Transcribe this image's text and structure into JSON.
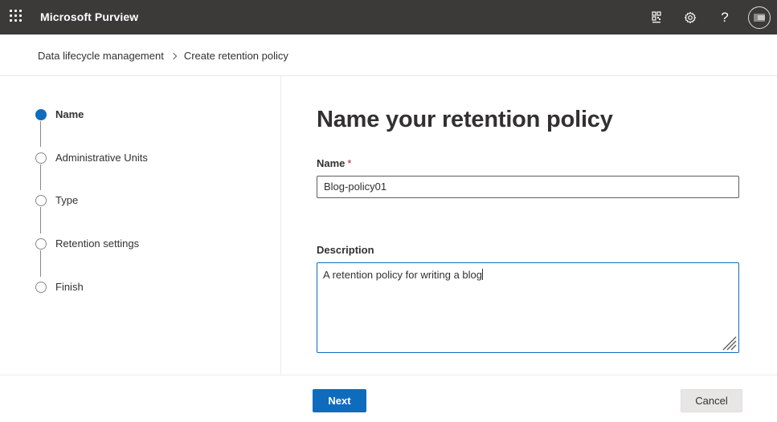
{
  "app": {
    "title": "Microsoft Purview"
  },
  "topbar": {
    "icons": [
      "app-launcher-icon",
      "qr-code-icon",
      "settings-gear-icon",
      "help-icon",
      "account-avatar"
    ],
    "help_glyph": "?"
  },
  "breadcrumb": {
    "items": [
      "Data lifecycle management",
      "Create retention policy"
    ]
  },
  "wizard": {
    "steps": [
      {
        "label": "Name",
        "state": "current"
      },
      {
        "label": "Administrative Units",
        "state": "upcoming"
      },
      {
        "label": "Type",
        "state": "upcoming"
      },
      {
        "label": "Retention settings",
        "state": "upcoming"
      },
      {
        "label": "Finish",
        "state": "upcoming"
      }
    ]
  },
  "form": {
    "title": "Name your retention policy",
    "name_label": "Name",
    "required_marker": "*",
    "name_value": "Blog-policy01",
    "description_label": "Description",
    "description_value": "A retention policy for writing a blog"
  },
  "footer": {
    "next_label": "Next",
    "cancel_label": "Cancel"
  },
  "colors": {
    "topbar": "#3b3a39",
    "accent": "#0f6cbd",
    "required": "#a4262c"
  }
}
